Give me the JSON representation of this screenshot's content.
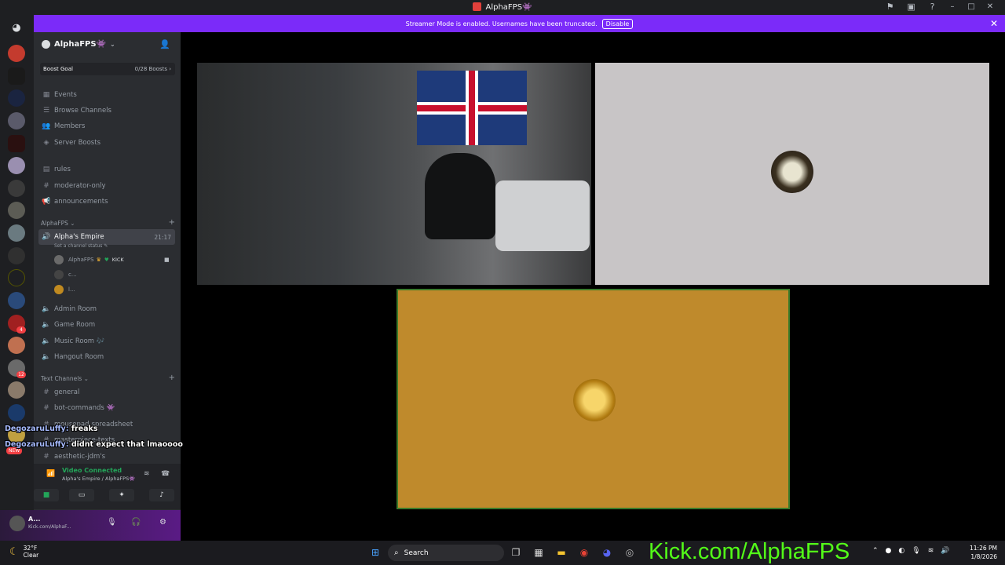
{
  "window": {
    "title": "AlphaFPS👾",
    "icons": [
      "inbox-flag-icon",
      "inbox-icon",
      "help-icon"
    ],
    "controls": [
      "minimize",
      "maximize",
      "close"
    ]
  },
  "banner": {
    "text": "Streamer Mode is enabled. Usernames have been truncated.",
    "button": "Disable",
    "bg": "#7b2bf9"
  },
  "rail": {
    "badges": [
      "4",
      "12"
    ],
    "new_label": "NEW"
  },
  "server": {
    "name": "AlphaFPS👾",
    "boost_goal": {
      "label": "Boost Goal",
      "count": "0/28 Boosts"
    },
    "menu": [
      "Events",
      "Browse Channels",
      "Members",
      "Server Boosts"
    ],
    "top_channels": [
      "rules",
      "moderator-only",
      "announcements"
    ],
    "voice_category": "AlphaFPS",
    "active_voice": {
      "name": "Alpha's Empire",
      "time": "21:17",
      "status": "Set a channel status"
    },
    "voice_users": [
      {
        "name": "AlphaFPS",
        "tag": "KICK"
      },
      {
        "name": "c..."
      },
      {
        "name": "l..."
      }
    ],
    "voice_channels": [
      "Admin Room",
      "Game Room",
      "Music Room 🎶",
      "Hangout Room"
    ],
    "text_category": "Text Channels",
    "text_channels": [
      "general",
      "bot-commands 👾",
      "mousepad-spreadsheet",
      "masterpiece-texts",
      "aesthetic-jdm's"
    ]
  },
  "chat_overlay": [
    {
      "user": "DegozaruLuffy:",
      "message": "freaks"
    },
    {
      "user": "DegozaruLuffy:",
      "message": "didnt expect that lmaoooo"
    }
  ],
  "voice_panel": {
    "title": "Video Connected",
    "subtitle": "Alpha's Empire / AlphaFPS👾"
  },
  "user_panel": {
    "name": "A...",
    "status": "Kick.com/AlphaF..."
  },
  "taskbar": {
    "weather_temp": "32°F",
    "weather_cond": "Clear",
    "search": "Search",
    "time": "11:26 PM",
    "date": "1/8/2026",
    "overlay_text": "Kick.com/AlphaFPS"
  },
  "colors": {
    "accent": "#7b2bf9",
    "connected": "#23a559",
    "kick_green": "#53fc18",
    "tile_gold": "#bf8a2c",
    "tile_grey": "#c8c5c6"
  }
}
